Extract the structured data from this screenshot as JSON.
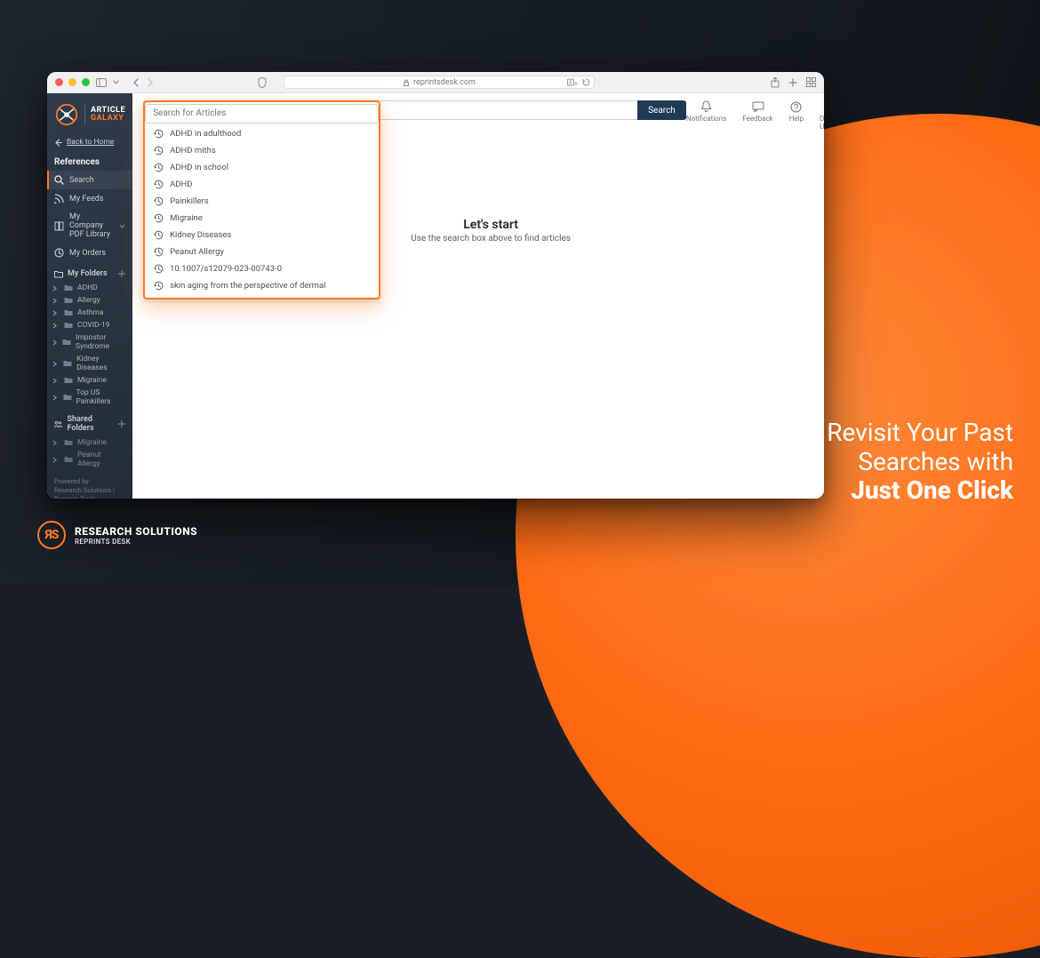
{
  "browser": {
    "url_domain": "reprintsdesk.com"
  },
  "app_name": {
    "line1": "ARTICLE",
    "line2": "GALAXY"
  },
  "sidebar": {
    "back_label": "Back to Home",
    "references_header": "References",
    "items": [
      {
        "label": "Search",
        "icon": "search"
      },
      {
        "label": "My Feeds",
        "icon": "rss"
      },
      {
        "label": "My Company PDF Library",
        "icon": "book"
      },
      {
        "label": "My Orders",
        "icon": "clock"
      }
    ],
    "my_folders_header": "My Folders",
    "my_folders": [
      "ADHD",
      "Allergy",
      "Asthma",
      "COVID-19",
      "Impostor Syndrome",
      "Kidney Diseases",
      "Migraine",
      "Top US Painkillers"
    ],
    "shared_folders_header": "Shared Folders",
    "shared_folders": [
      "Migraine",
      "Peanut Allergy"
    ],
    "footer_line1": "Powered by",
    "footer_line2": "Research Solutions | Reprints Desk"
  },
  "topbar": {
    "search_placeholder": "Search for Articles",
    "search_button": "Search",
    "actions": [
      {
        "label": "Notifications"
      },
      {
        "label": "Feedback"
      },
      {
        "label": "Help"
      },
      {
        "label": "Demo User"
      }
    ]
  },
  "suggestions": [
    "ADHD in adulthood",
    "ADHD miths",
    "ADHD in school",
    "ADHD",
    "Painkillers",
    "Migraine",
    "Kidney Diseases",
    "Peanut Allergy",
    "10.1007/s12079-023-00743-0",
    "skin aging from the perspective of dermal"
  ],
  "empty_state": {
    "title": "Let's start",
    "subtitle": "Use the search box above to find articles"
  },
  "promo": {
    "line1": "Revisit Your Past",
    "line2": "Searches with",
    "line3": "Just One Click"
  },
  "footer": {
    "line1": "RESEARCH SOLUTIONS",
    "line2": "REPRINTS DESK"
  }
}
